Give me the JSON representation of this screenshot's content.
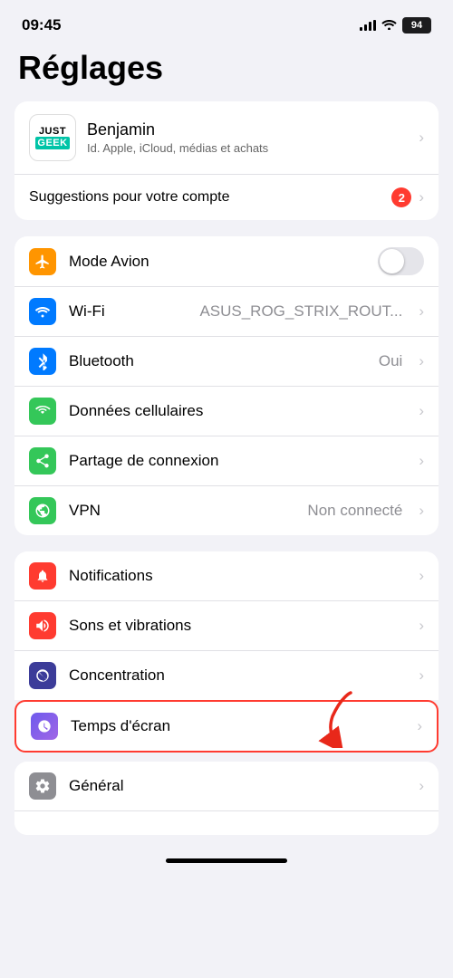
{
  "statusBar": {
    "time": "09:45",
    "battery": "94"
  },
  "pageTitle": "Réglages",
  "account": {
    "logoLine1": "JUST",
    "logoLine2": "GEEK",
    "name": "Benjamin",
    "subtitle": "Id. Apple, iCloud, médias et achats"
  },
  "suggestion": {
    "text": "Suggestions pour votre compte",
    "badge": "2"
  },
  "networkSection": [
    {
      "id": "avion",
      "label": "Mode Avion",
      "value": "",
      "type": "toggle",
      "icon": "✈",
      "iconClass": "ic-orange"
    },
    {
      "id": "wifi",
      "label": "Wi-Fi",
      "value": "ASUS_ROG_STRIX_ROUT...",
      "type": "chevron",
      "icon": "📶",
      "iconClass": "ic-blue"
    },
    {
      "id": "bluetooth",
      "label": "Bluetooth",
      "value": "Oui",
      "type": "chevron",
      "icon": "🔷",
      "iconClass": "ic-blue2"
    },
    {
      "id": "cellulaires",
      "label": "Données cellulaires",
      "value": "",
      "type": "chevron",
      "icon": "📡",
      "iconClass": "ic-green"
    },
    {
      "id": "partage",
      "label": "Partage de connexion",
      "value": "",
      "type": "chevron",
      "icon": "🔗",
      "iconClass": "ic-green2"
    },
    {
      "id": "vpn",
      "label": "VPN",
      "value": "Non connecté",
      "type": "chevron",
      "icon": "🌐",
      "iconClass": "ic-green3"
    }
  ],
  "notifSection": [
    {
      "id": "notif",
      "label": "Notifications",
      "value": "",
      "type": "chevron",
      "icon": "🔔",
      "iconClass": "ic-red"
    },
    {
      "id": "sons",
      "label": "Sons et vibrations",
      "value": "",
      "type": "chevron",
      "icon": "🔊",
      "iconClass": "ic-red2"
    },
    {
      "id": "concentration",
      "label": "Concentration",
      "value": "",
      "type": "chevron",
      "icon": "🌙",
      "iconClass": "ic-indigo"
    },
    {
      "id": "temps",
      "label": "Temps d'écran",
      "value": "",
      "type": "chevron",
      "icon": "⏳",
      "iconClass": "ic-purple2"
    }
  ],
  "partialSection": [
    {
      "id": "general",
      "label": "Général",
      "value": "",
      "type": "chevron",
      "icon": "⚙",
      "iconClass": "ic-gray"
    }
  ]
}
